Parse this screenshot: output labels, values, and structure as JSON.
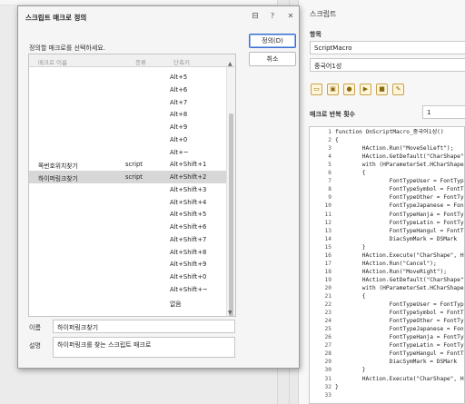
{
  "dialog": {
    "title": "스크립트 매크로 정의",
    "description": "정의할 매크로를 선택하세요.",
    "columns": [
      "매크로 이름",
      "종류",
      "단축키"
    ],
    "rows": [
      {
        "name": "",
        "type": "",
        "shortcut": "Alt+5"
      },
      {
        "name": "",
        "type": "",
        "shortcut": "Alt+6"
      },
      {
        "name": "",
        "type": "",
        "shortcut": "Alt+7"
      },
      {
        "name": "",
        "type": "",
        "shortcut": "Alt+8"
      },
      {
        "name": "",
        "type": "",
        "shortcut": "Alt+9"
      },
      {
        "name": "",
        "type": "",
        "shortcut": "Alt+0"
      },
      {
        "name": "",
        "type": "",
        "shortcut": "Alt+~"
      },
      {
        "name": "쪽번호위치찾기",
        "type": "script",
        "shortcut": "Alt+Shift+1"
      },
      {
        "name": "하이퍼링크찾기",
        "type": "script",
        "shortcut": "Alt+Shift+2",
        "selected": true
      },
      {
        "name": "",
        "type": "",
        "shortcut": "Alt+Shift+3"
      },
      {
        "name": "",
        "type": "",
        "shortcut": "Alt+Shift+4"
      },
      {
        "name": "",
        "type": "",
        "shortcut": "Alt+Shift+5"
      },
      {
        "name": "",
        "type": "",
        "shortcut": "Alt+Shift+6"
      },
      {
        "name": "",
        "type": "",
        "shortcut": "Alt+Shift+7"
      },
      {
        "name": "",
        "type": "",
        "shortcut": "Alt+Shift+8"
      },
      {
        "name": "",
        "type": "",
        "shortcut": "Alt+Shift+9"
      },
      {
        "name": "",
        "type": "",
        "shortcut": "Alt+Shift+0"
      },
      {
        "name": "",
        "type": "",
        "shortcut": "Alt+Shift+~"
      },
      {
        "name": "",
        "type": "",
        "shortcut": "없음"
      }
    ],
    "define_button": "정의(D)",
    "cancel_button": "취소",
    "name_label": "이름",
    "name_value": "하이퍼링크찾기",
    "desc_label": "설명",
    "desc_value": "하이퍼링크를 찾는 스크립트 매크로"
  },
  "right_panel": {
    "title": "스크립트",
    "items_heading": "항목",
    "item1": "ScriptMacro",
    "item2": "중국어1성",
    "repeat_label": "매크로 반복 횟수",
    "repeat_value": "1",
    "toolbar_icons": [
      "open-icon",
      "save-icon",
      "record-icon",
      "run-icon",
      "stop-icon",
      "edit-icon"
    ],
    "code_lines": [
      {
        "n": "1",
        "t": "function OnScriptMacro_중국어1성()"
      },
      {
        "n": "2",
        "t": "{"
      },
      {
        "n": "3",
        "t": "        HAction.Run(\"MoveSelLeft\");"
      },
      {
        "n": "4",
        "t": "        HAction.GetDefault(\"CharShape\","
      },
      {
        "n": "5",
        "t": "        with (HParameterSet.HCharShape"
      },
      {
        "n": "6",
        "t": "        {"
      },
      {
        "n": "7",
        "t": "                FontTypeUser = FontTyp"
      },
      {
        "n": "8",
        "t": "                FontTypeSymbol = FontT"
      },
      {
        "n": "9",
        "t": "                FontTypeOther = FontTy"
      },
      {
        "n": "10",
        "t": "                FontTypeJapanese = Fon"
      },
      {
        "n": "11",
        "t": "                FontTypeHanja = FontTyp"
      },
      {
        "n": "12",
        "t": "                FontTypeLatin = FontTyp"
      },
      {
        "n": "13",
        "t": "                FontTypeHangul = FontTy"
      },
      {
        "n": "14",
        "t": "                DiacSymMark = DSMark"
      },
      {
        "n": "15",
        "t": "        }"
      },
      {
        "n": "16",
        "t": "        HAction.Execute(\"CharShape\", HP"
      },
      {
        "n": "17",
        "t": "        HAction.Run(\"Cancel\");"
      },
      {
        "n": "18",
        "t": "        HAction.Run(\"MoveRight\");"
      },
      {
        "n": "19",
        "t": "        HAction.GetDefault(\"CharShape\","
      },
      {
        "n": "20",
        "t": "        with (HParameterSet.HCharShape"
      },
      {
        "n": "21",
        "t": "        {"
      },
      {
        "n": "22",
        "t": "                FontTypeUser = FontTyp"
      },
      {
        "n": "23",
        "t": "                FontTypeSymbol = FontT"
      },
      {
        "n": "24",
        "t": "                FontTypeOther = FontTy"
      },
      {
        "n": "25",
        "t": "                FontTypeJapanese = Fon"
      },
      {
        "n": "26",
        "t": "                FontTypeHanja = FontTyp"
      },
      {
        "n": "27",
        "t": "                FontTypeLatin = FontTyp"
      },
      {
        "n": "28",
        "t": "                FontTypeHangul = FontTy"
      },
      {
        "n": "29",
        "t": "                DiacSymMark = DSMark"
      },
      {
        "n": "30",
        "t": "        }"
      },
      {
        "n": "31",
        "t": "        HAction.Execute(\"CharShape\", HP"
      },
      {
        "n": "32",
        "t": "}"
      },
      {
        "n": "33",
        "t": ""
      }
    ]
  }
}
